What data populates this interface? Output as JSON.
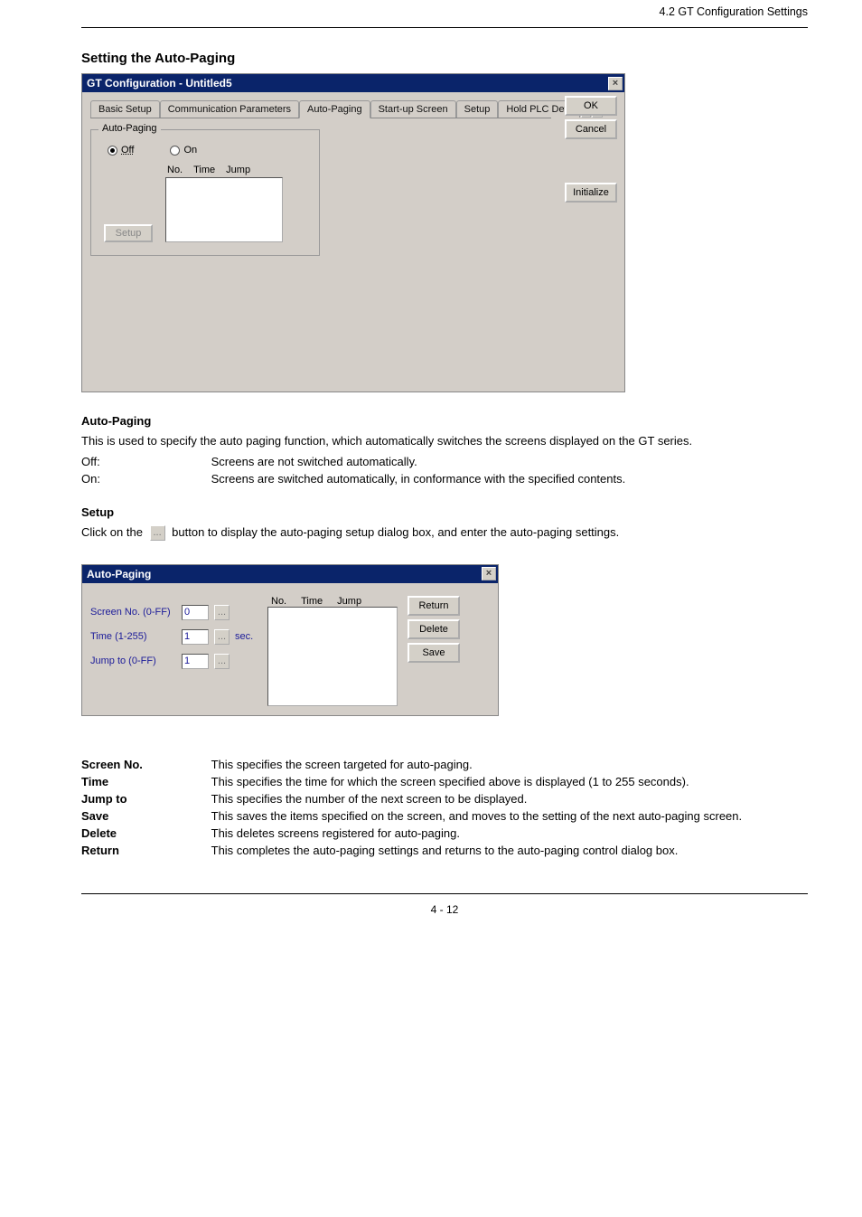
{
  "header": {
    "right": "4.2 GT Configuration Settings"
  },
  "section_heading": "Setting the Auto-Paging",
  "page_number": "4 - 12",
  "dialog1": {
    "title": "GT Configuration - Untitled5",
    "tabs": {
      "t1": "Basic Setup",
      "t2": "Communication Parameters",
      "t3": "Auto-Paging",
      "t4": "Start-up Screen",
      "t5": "Setup",
      "t6": "Hold PLC Devi"
    },
    "close_x": "×",
    "scroll_left": "◄",
    "scroll_right": "►",
    "ok": "OK",
    "cancel": "Cancel",
    "initialize": "Initialize",
    "group_legend": "Auto-Paging",
    "radio_off": "Off",
    "radio_on": "On",
    "col_no": "No.",
    "col_time": "Time",
    "col_jump": "Jump",
    "setup": "Setup"
  },
  "body1": {
    "ap_label": "Auto-Paging",
    "ap_desc": "This is used to specify the auto paging function, which automatically switches the screens displayed on the GT series.",
    "off_label": "Off:",
    "off_desc": "Screens are not switched automatically.",
    "on_label": "On:",
    "on_desc": "Screens are switched automatically, in conformance with the specified contents.",
    "setup_label": "Setup",
    "setup_desc_1": "Click on the",
    "setup_desc_2": "button to display the auto-paging setup dialog box, and enter the auto-paging settings."
  },
  "ellipsis_icon": "...",
  "dialog2": {
    "title": "Auto-Paging",
    "close_x": "×",
    "screen_no_label": "Screen No. (0-FF)",
    "screen_no_value": "0",
    "time_label": "Time (1-255)",
    "time_value": "1",
    "time_unit": "sec.",
    "jump_label": "Jump to (0-FF)",
    "jump_value": "1",
    "col_no": "No.",
    "col_time": "Time",
    "col_jump": "Jump",
    "return": "Return",
    "delete": "Delete",
    "save": "Save",
    "ell": "..."
  },
  "body2": {
    "screen_no_label": "Screen No.",
    "screen_no_desc": "This specifies the screen targeted for auto-paging.",
    "time_label": "Time",
    "time_desc": "This specifies the time for which the screen specified above is displayed (1 to 255 seconds).",
    "jump_label": "Jump to",
    "jump_desc": "This specifies the number of the next screen to be displayed.",
    "save_label": "Save",
    "save_desc": "This saves the items specified on the screen, and moves to the setting of the next auto-paging screen.",
    "delete_label": "Delete",
    "delete_desc": "This deletes screens registered for auto-paging.",
    "return_label": "Return",
    "return_desc": "This completes the auto-paging settings and returns to the auto-paging control dialog box."
  }
}
